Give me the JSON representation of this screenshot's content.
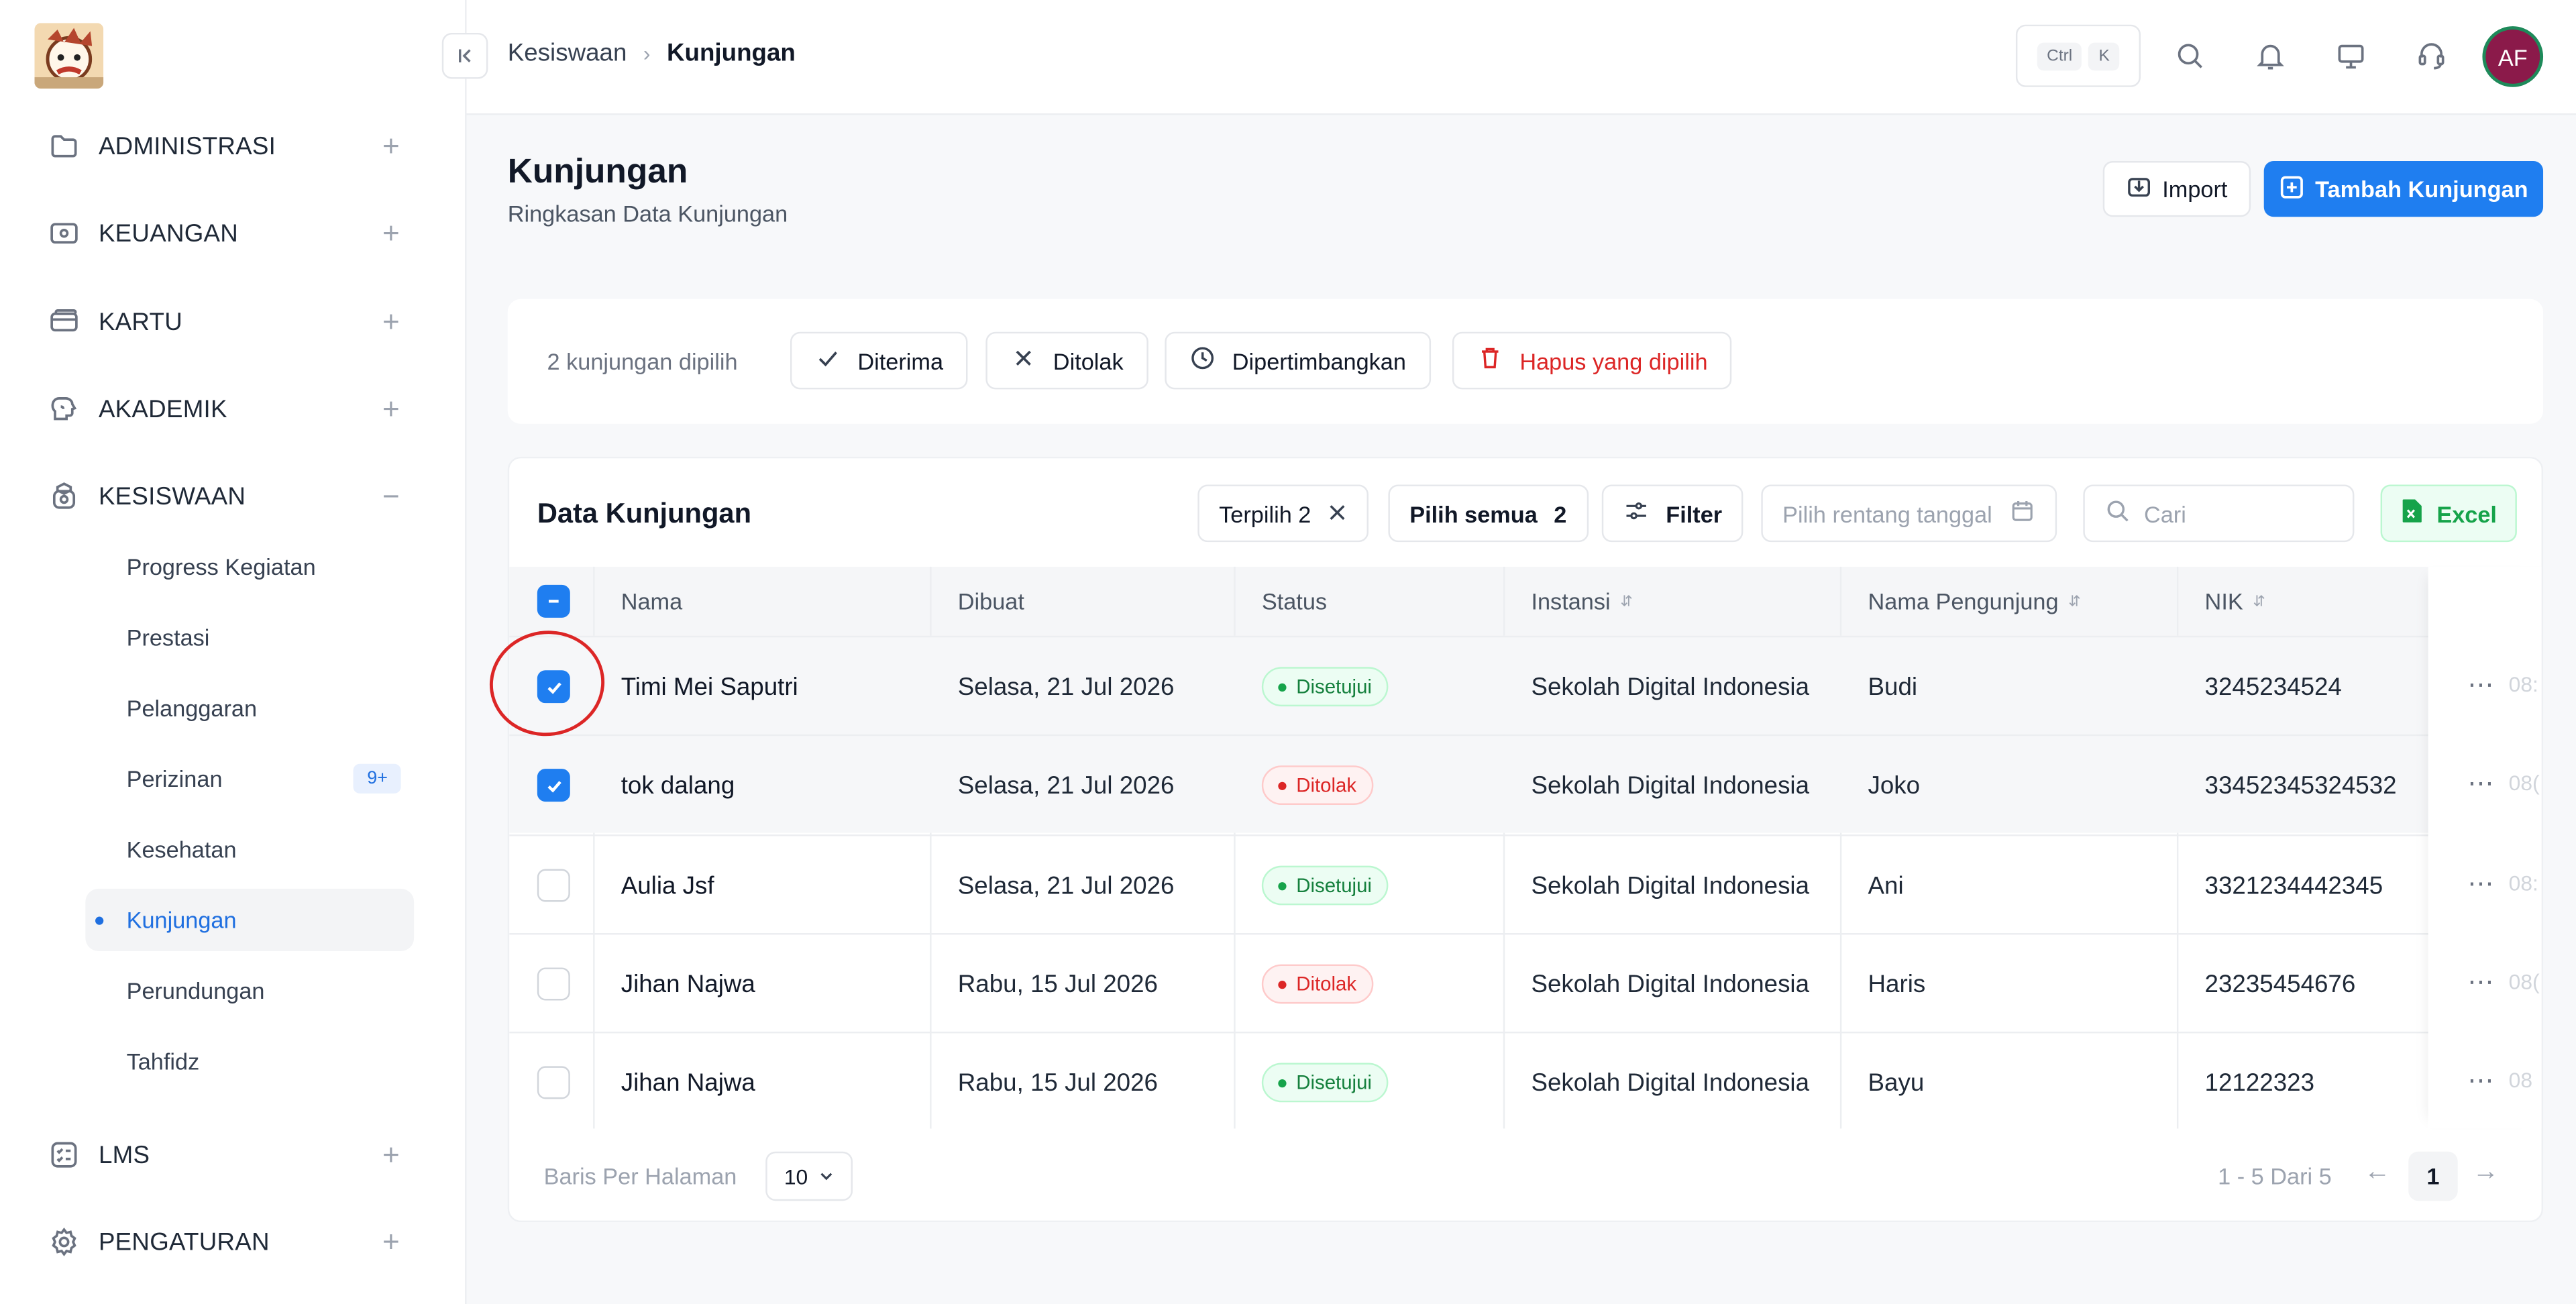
{
  "breadcrumb": {
    "parent": "Kesiswaan",
    "current": "Kunjungan"
  },
  "shortcut": {
    "key1": "Ctrl",
    "key2": "K"
  },
  "user": {
    "initials": "AF"
  },
  "sidebar": {
    "sections": [
      {
        "label": "ADMINISTRASI",
        "toggle": "+"
      },
      {
        "label": "KEUANGAN",
        "toggle": "+"
      },
      {
        "label": "KARTU",
        "toggle": "+"
      },
      {
        "label": "AKADEMIK",
        "toggle": "+"
      },
      {
        "label": "KESISWAAN",
        "toggle": "−"
      },
      {
        "label": "LMS",
        "toggle": "+"
      },
      {
        "label": "PENGATURAN",
        "toggle": "+"
      }
    ],
    "sub_items": [
      {
        "label": "Progress Kegiatan"
      },
      {
        "label": "Prestasi"
      },
      {
        "label": "Pelanggaran"
      },
      {
        "label": "Perizinan",
        "badge": "9+"
      },
      {
        "label": "Kesehatan"
      },
      {
        "label": "Kunjungan",
        "active": true
      },
      {
        "label": "Perundungan"
      },
      {
        "label": "Tahfidz"
      }
    ]
  },
  "page": {
    "title": "Kunjungan",
    "subtitle": "Ringkasan Data Kunjungan",
    "import_label": "Import",
    "add_label": "Tambah Kunjungan"
  },
  "bulk": {
    "count_text": "2 kunjungan dipilih",
    "accept": "Diterima",
    "reject": "Ditolak",
    "consider": "Dipertimbangkan",
    "delete": "Hapus yang dipilih"
  },
  "table": {
    "title": "Data Kunjungan",
    "selected_chip": "Terpilih 2",
    "select_all_label": "Pilih semua",
    "select_all_count": "2",
    "filter_label": "Filter",
    "date_placeholder": "Pilih rentang tanggal",
    "search_placeholder": "Cari",
    "excel_label": "Excel",
    "columns": [
      "Nama",
      "Dibuat",
      "Status",
      "Instansi",
      "Nama Pengunjung",
      "NIK"
    ],
    "rows": [
      {
        "checked": true,
        "nama": "Timi Mei Saputri",
        "dibuat": "Selasa, 21 Jul 2026",
        "status": "Disetujui",
        "status_type": "ok",
        "instansi": "Sekolah Digital Indonesia",
        "pengunjung": "Budi",
        "nik": "3245234524",
        "extra": "08:"
      },
      {
        "checked": true,
        "nama": "tok dalang",
        "dibuat": "Selasa, 21 Jul 2026",
        "status": "Ditolak",
        "status_type": "no",
        "instansi": "Sekolah Digital Indonesia",
        "pengunjung": "Joko",
        "nik": "33452345324532",
        "extra": "08("
      },
      {
        "checked": false,
        "nama": "Aulia Jsf",
        "dibuat": "Selasa, 21 Jul 2026",
        "status": "Disetujui",
        "status_type": "ok",
        "instansi": "Sekolah Digital Indonesia",
        "pengunjung": "Ani",
        "nik": "3321234442345",
        "extra": "08:"
      },
      {
        "checked": false,
        "nama": "Jihan Najwa",
        "dibuat": "Rabu, 15 Jul 2026",
        "status": "Ditolak",
        "status_type": "no",
        "instansi": "Sekolah Digital Indonesia",
        "pengunjung": "Haris",
        "nik": "23235454676",
        "extra": "08("
      },
      {
        "checked": false,
        "nama": "Jihan Najwa",
        "dibuat": "Rabu, 15 Jul 2026",
        "status": "Disetujui",
        "status_type": "ok",
        "instansi": "Sekolah Digital Indonesia",
        "pengunjung": "Bayu",
        "nik": "12122323",
        "extra": "08"
      }
    ],
    "rows_per_page_label": "Baris Per Halaman",
    "rows_per_page": "10",
    "range_text": "1 - 5 Dari 5",
    "current_page": "1"
  }
}
